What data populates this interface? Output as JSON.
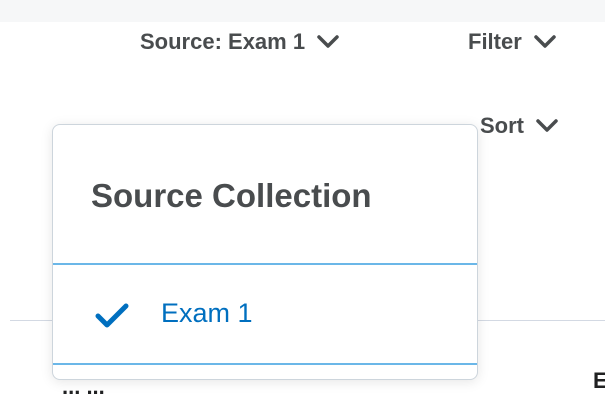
{
  "toolbar": {
    "source_label": "Source: Exam 1",
    "filter_label": "Filter",
    "sort_label": "Sort"
  },
  "dropdown": {
    "title": "Source Collection",
    "items": [
      {
        "label": "Exam 1",
        "selected": true
      }
    ]
  },
  "background": {
    "partial_question": "... ...",
    "partial_right": "E"
  },
  "icons": {
    "chevron": "chevron-down-icon",
    "check": "checkmark-icon"
  },
  "colors": {
    "accent": "#006fbf",
    "separator": "#6bb7e8",
    "text_dark": "#494c4e"
  }
}
